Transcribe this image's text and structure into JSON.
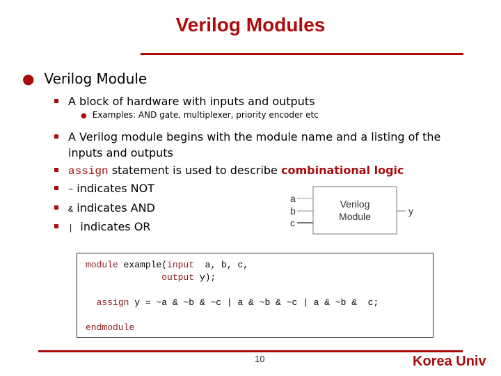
{
  "slide": {
    "title": "Verilog Modules",
    "page_number": "10",
    "footer_brand": "Korea Univ",
    "accent_color": "#a90b0b"
  },
  "bullets": {
    "l1": "Verilog Module",
    "b1": "A block of hardware with inputs and outputs",
    "b1_sub": "Examples: AND gate, multiplexer, priority encoder etc",
    "b2_line1": "A Verilog module begins with the module name and a listing of the",
    "b2_line2": "inputs and outputs",
    "b3_code": "assign",
    "b3_text": " statement is used to describe ",
    "b3_emph": "combinational logic",
    "b4_sym": "~",
    "b4_text": " indicates NOT",
    "b5_sym": "&",
    "b5_text": " indicates AND",
    "b6_sym": "|",
    "b6_text": "  indicates OR"
  },
  "diagram": {
    "inputs": [
      "a",
      "b",
      "c"
    ],
    "output": "y",
    "box_line1": "Verilog",
    "box_line2": "Module"
  },
  "code": {
    "l1_kw1": "module",
    "l1_mid": " example(",
    "l1_kw2": "input",
    "l1_rest": "  a, b, c,",
    "l2_indent": "              ",
    "l2_kw": "output",
    "l2_rest": " y);",
    "l3_indent": "  ",
    "l3_kw": "assign",
    "l3_rest": " y = ~a & ~b & ~c | a & ~b & ~c | a & ~b &  c;",
    "l4_kw": "endmodule"
  }
}
